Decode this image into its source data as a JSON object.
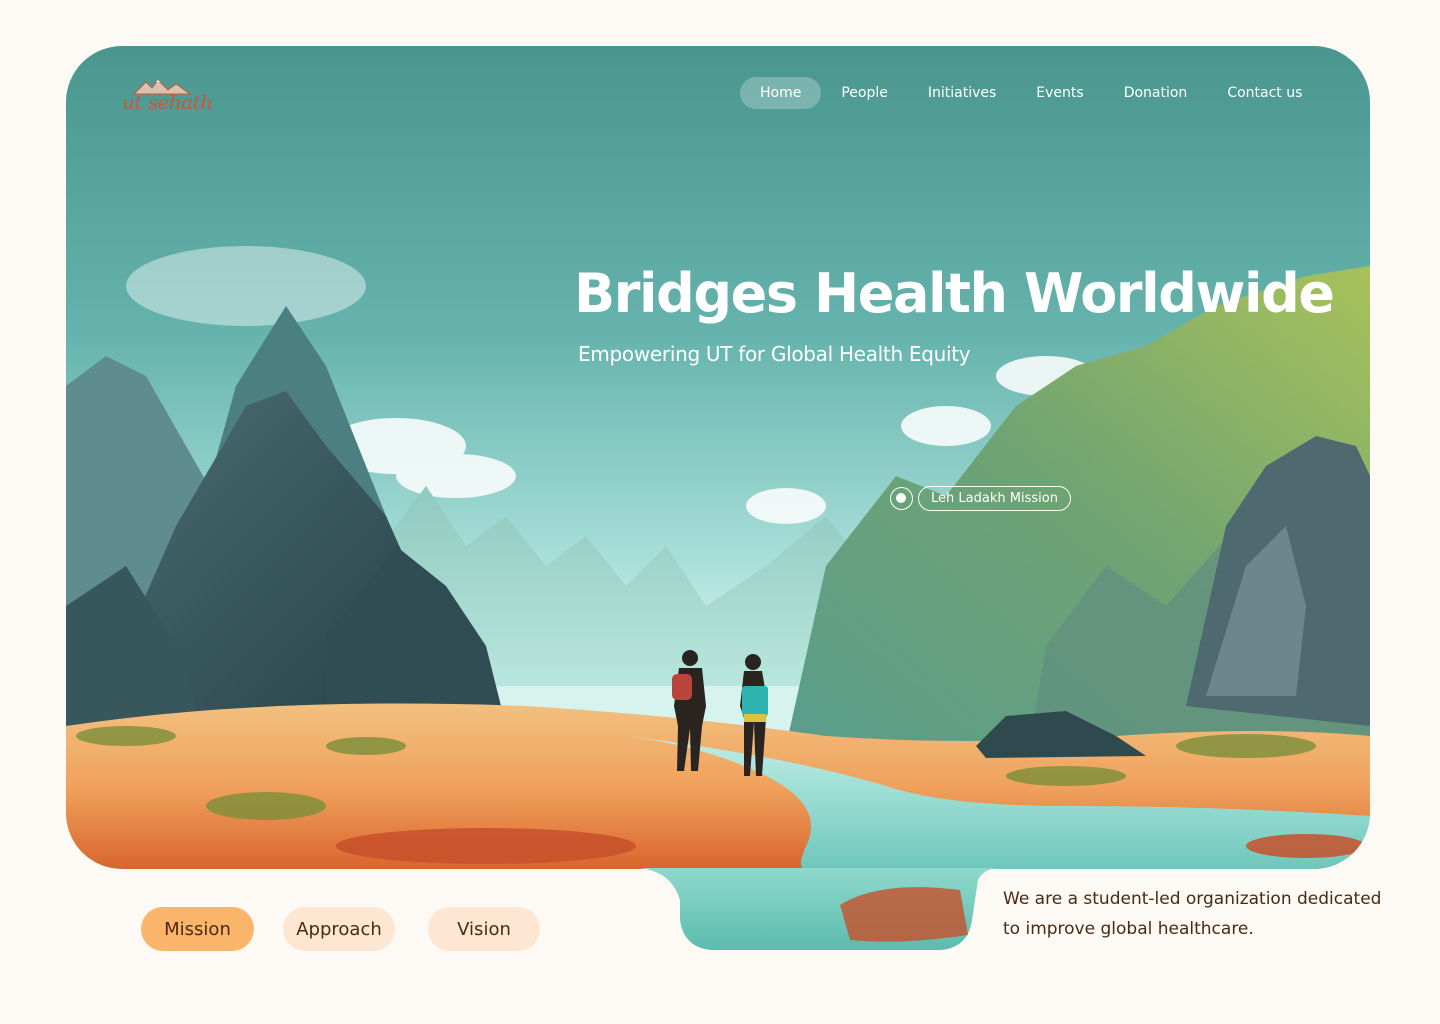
{
  "brand": {
    "logo_text": "ut sehath",
    "logo_color": "#c8583a"
  },
  "nav": {
    "items": [
      {
        "label": "Home",
        "active": true
      },
      {
        "label": "People"
      },
      {
        "label": "Initiatives"
      },
      {
        "label": "Events"
      },
      {
        "label": "Donation"
      },
      {
        "label": "Contact us"
      }
    ]
  },
  "hero": {
    "title": "Bridges Health Worldwide",
    "subtitle": "Empowering UT for Global Health Equity",
    "location_tag": "Leh Ladakh Mission"
  },
  "sections": {
    "mission": "Mission",
    "approach": "Approach",
    "vision": "Vision"
  },
  "tagline": "We are a student-led organization dedicated to improve global healthcare.",
  "colors": {
    "page_bg": "#fdf9f4",
    "pill_active": "#fbb56a",
    "pill_inactive": "#fde7d3",
    "text_dark": "#4a2a12",
    "sky_teal": "#4b9a94"
  }
}
